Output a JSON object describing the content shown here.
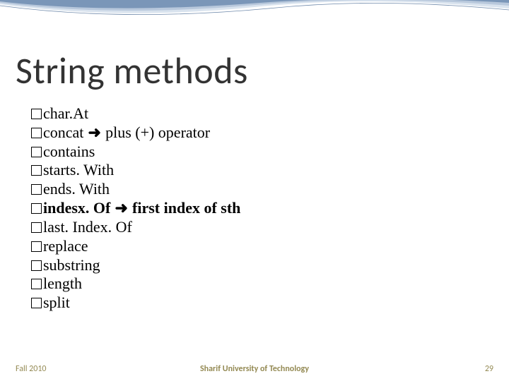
{
  "title": "String methods",
  "items": [
    {
      "text": "char.At",
      "bold": false,
      "arrow": "",
      "after": ""
    },
    {
      "text": "concat",
      "bold": false,
      "arrow": " ➜ ",
      "after": "plus (+) operator"
    },
    {
      "text": "contains",
      "bold": false,
      "arrow": "",
      "after": ""
    },
    {
      "text": "starts. With",
      "bold": false,
      "arrow": "",
      "after": ""
    },
    {
      "text": "ends. With",
      "bold": false,
      "arrow": "",
      "after": ""
    },
    {
      "text": "indesx. Of",
      "bold": true,
      "arrow": " ➜ ",
      "after": "first index of sth"
    },
    {
      "text": "last. Index. Of",
      "bold": false,
      "arrow": "",
      "after": ""
    },
    {
      "text": "replace",
      "bold": false,
      "arrow": "",
      "after": ""
    },
    {
      "text": "substring",
      "bold": false,
      "arrow": "",
      "after": ""
    },
    {
      "text": "length",
      "bold": false,
      "arrow": "",
      "after": ""
    },
    {
      "text": "split",
      "bold": false,
      "arrow": "",
      "after": ""
    }
  ],
  "footer": {
    "left": "Fall 2010",
    "center": "Sharif University of Technology",
    "right": "29"
  },
  "colors": {
    "wave1": "#7a96b8",
    "wave2": "#b8c8dc",
    "wave3": "#d9e3ee",
    "footer": "#948a54"
  }
}
